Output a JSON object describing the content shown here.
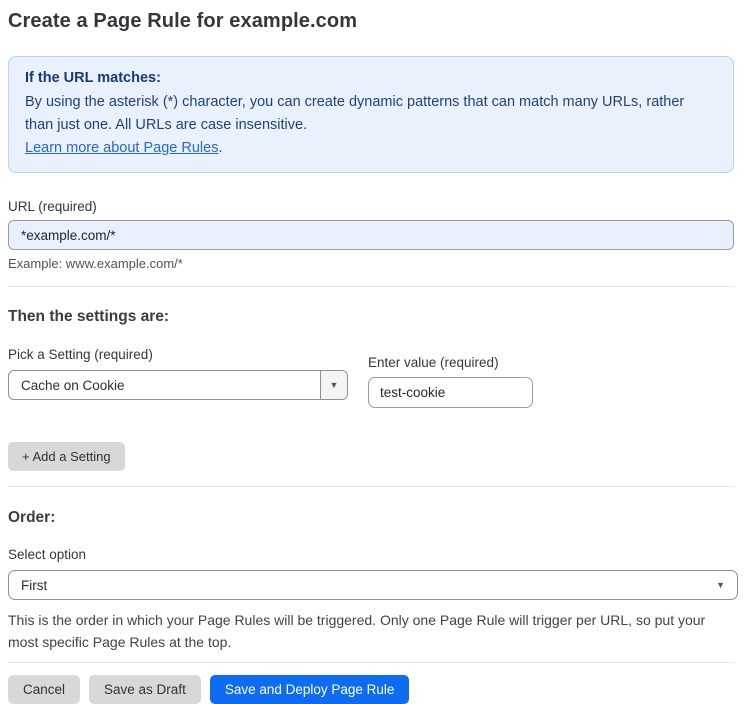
{
  "colors": {
    "accent_blue": "#0d6cf2",
    "info_box_bg": "#e9f2fc",
    "info_box_border": "#b7d4f1",
    "info_text": "#1f4180",
    "link_blue": "#2a67cf",
    "url_input_bg": "#e8f0fe",
    "gray_button_bg": "#d8d8d8"
  },
  "header": {
    "title": "Create a Page Rule for example.com"
  },
  "info_box": {
    "heading": "If the URL matches:",
    "body": "By using the asterisk (*) character, you can create dynamic patterns that can match many URLs, rather than just one. All URLs are case insensitive.",
    "link_label": "Learn more about Page Rules",
    "link_suffix": "."
  },
  "url_field": {
    "label": "URL (required)",
    "value": "*example.com/*",
    "example": "Example: www.example.com/*"
  },
  "settings": {
    "heading": "Then the settings are:",
    "pick_label": "Pick a Setting (required)",
    "pick_value": "Cache on Cookie",
    "value_label": "Enter value (required)",
    "value_text": "test-cookie",
    "add_button_label": "+ Add a Setting",
    "dropdown_arrow": "▼"
  },
  "order": {
    "heading": "Order:",
    "select_label": "Select option",
    "select_value": "First",
    "select_arrow": "▼",
    "help_text": "This is the order in which your Page Rules will be triggered. Only one Page Rule will trigger per URL, so put your most specific Page Rules at the top."
  },
  "footer": {
    "cancel_label": "Cancel",
    "save_draft_label": "Save as Draft",
    "save_deploy_label": "Save and Deploy Page Rule"
  }
}
